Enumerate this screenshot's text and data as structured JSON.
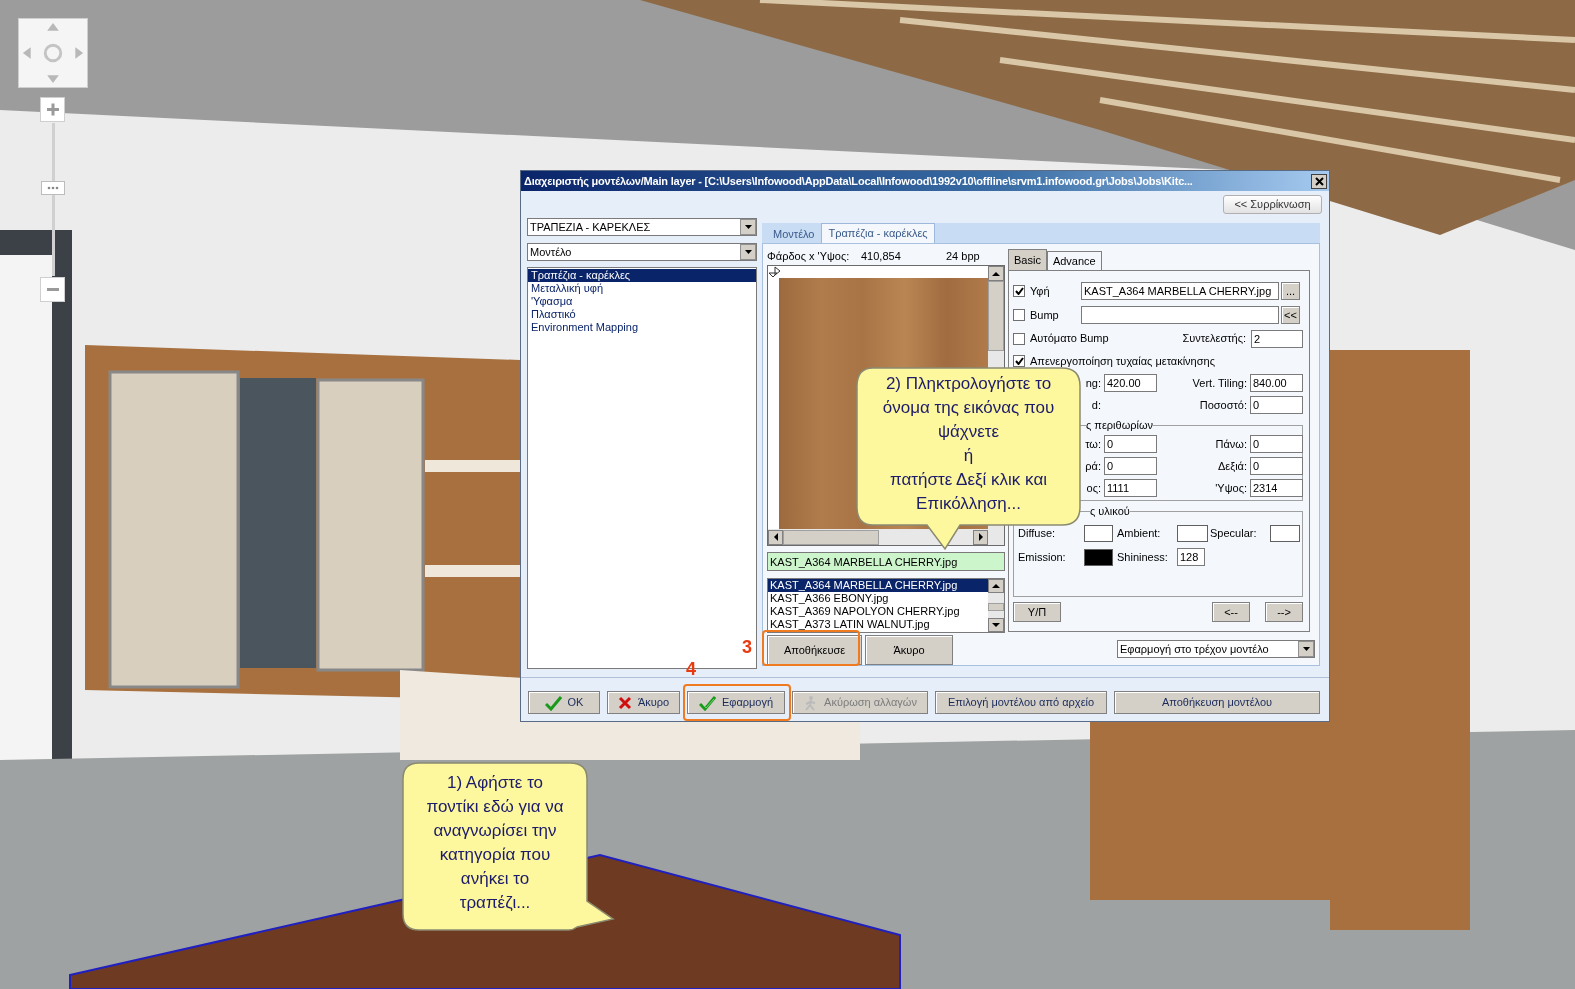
{
  "dialog": {
    "title": "Διαχειριστής μοντέλων/Main layer - [C:\\Users\\Infowood\\AppData\\Local\\Infowood\\1992v10\\offline\\srvm1.infowood.gr\\Jobs\\Jobs\\Kitc...",
    "collapse_button": "<< Συρρίκνωση",
    "category_combo": "ΤΡΑΠΕΖΙΑ - ΚΑΡΕΚΛΕΣ",
    "type_combo": "Μοντέλο",
    "material_list": [
      {
        "label": "Τραπέζια - καρέκλες",
        "selected": true
      },
      {
        "label": "Μεταλλική υφή",
        "selected": false
      },
      {
        "label": "'Υφασμα",
        "selected": false
      },
      {
        "label": "Πλαστικό",
        "selected": false
      },
      {
        "label": "Environment Mapping",
        "selected": false
      }
    ],
    "tabs": [
      {
        "label": "Μοντέλο",
        "selected": false
      },
      {
        "label": "Τραπέζια - καρέκλες",
        "selected": true
      }
    ],
    "preview": {
      "size_label": "Φάρδος x 'Υψος:",
      "size_value": "410,854",
      "depth": "24 bpp"
    },
    "filename_field": "KAST_A364 MARBELLA CHERRY.jpg",
    "file_list": [
      {
        "label": "KAST_A364 MARBELLA CHERRY.jpg",
        "selected": true
      },
      {
        "label": "KAST_A366 EBONY.jpg",
        "selected": false
      },
      {
        "label": "KAST_A369 NAPOLYON CHERRY.jpg",
        "selected": false
      },
      {
        "label": "KAST_A373 LATIN WALNUT.jpg",
        "selected": false
      }
    ],
    "save_button": "Αποθήκευσε",
    "cancel_button": "Άκυρο",
    "sub_tabs": [
      {
        "label": "Basic",
        "selected": true
      },
      {
        "label": "Advance",
        "selected": false
      }
    ],
    "texture": {
      "checked": true,
      "label": "Υφή",
      "value": "KAST_A364 MARBELLA CHERRY.jpg",
      "button": "..."
    },
    "bump": {
      "checked": false,
      "label": "Bump",
      "button": "<<"
    },
    "auto_bump": {
      "checked": false,
      "label": "Αυτόματο Bump",
      "coef_label": "Συντελεστής:",
      "coef_value": "2"
    },
    "disable_random": {
      "checked": true,
      "label": "Απενεργοποίηση τυχαίας μετακίνησης"
    },
    "tiling_rows": [
      [
        {
          "label": "ng:",
          "value": "420.00"
        },
        {
          "label": "Vert. Tiling:",
          "value": "840.00"
        }
      ],
      [
        {
          "label": "d:"
        },
        {
          "label": "Ποσοστό:",
          "value": "0"
        }
      ]
    ],
    "margins_group": {
      "title": "ς περιθωρίων",
      "rows": [
        [
          {
            "label": "τω:",
            "value": "0"
          },
          {
            "label": "Πάνω:",
            "value": "0"
          }
        ],
        [
          {
            "label": "ρά:",
            "value": "0"
          },
          {
            "label": "Δεξιά:",
            "value": "0"
          }
        ],
        [
          {
            "label": "ος:",
            "value": "1111"
          },
          {
            "label": "'Υψος:",
            "value": "2314"
          }
        ]
      ]
    },
    "material_group": {
      "title": "ς υλικού",
      "swatches": [
        {
          "label": "Diffuse:",
          "color": "#ffffff"
        },
        {
          "label": "Ambient:",
          "color": "#ffffff"
        },
        {
          "label": "Specular:",
          "color": "#ffffff"
        },
        {
          "label": "Emission:",
          "color": "#000000"
        }
      ],
      "shininess_label": "Shininess:",
      "shininess_value": "128"
    },
    "yp_button": "Υ/Π",
    "prev_button": "<--",
    "next_button": "-->",
    "apply_combo": "Εφαρμογή στο τρέχον μοντέλο",
    "footer_buttons": [
      {
        "label": "OK",
        "kind": "ok",
        "disabled": false
      },
      {
        "label": "Άκυρο",
        "kind": "cancel",
        "disabled": false
      },
      {
        "label": "Εφαρμογή",
        "kind": "apply",
        "disabled": false
      },
      {
        "label": "Ακύρωση αλλαγών",
        "kind": "undo",
        "disabled": true
      },
      {
        "label": "Επιλογή μοντέλου από αρχείο",
        "kind": "plain",
        "disabled": false
      },
      {
        "label": "Αποθήκευση μοντέλου",
        "kind": "plain",
        "disabled": false
      }
    ]
  },
  "zoom_slider": {
    "level": 0.58
  },
  "step_markers": [
    "3",
    "4"
  ],
  "callouts": [
    "2) Πληκτρολογήστε το\nόνομα της εικόνας που\nψάχνετε\nή\nπατήστε Δεξί κλικ και\nΕπικόλληση...",
    "1) Αφήστε το\nποντίκι εδώ για να\nαναγνωρίσει την\nκατηγορία που\nανήκει το\nτραπέζι..."
  ]
}
